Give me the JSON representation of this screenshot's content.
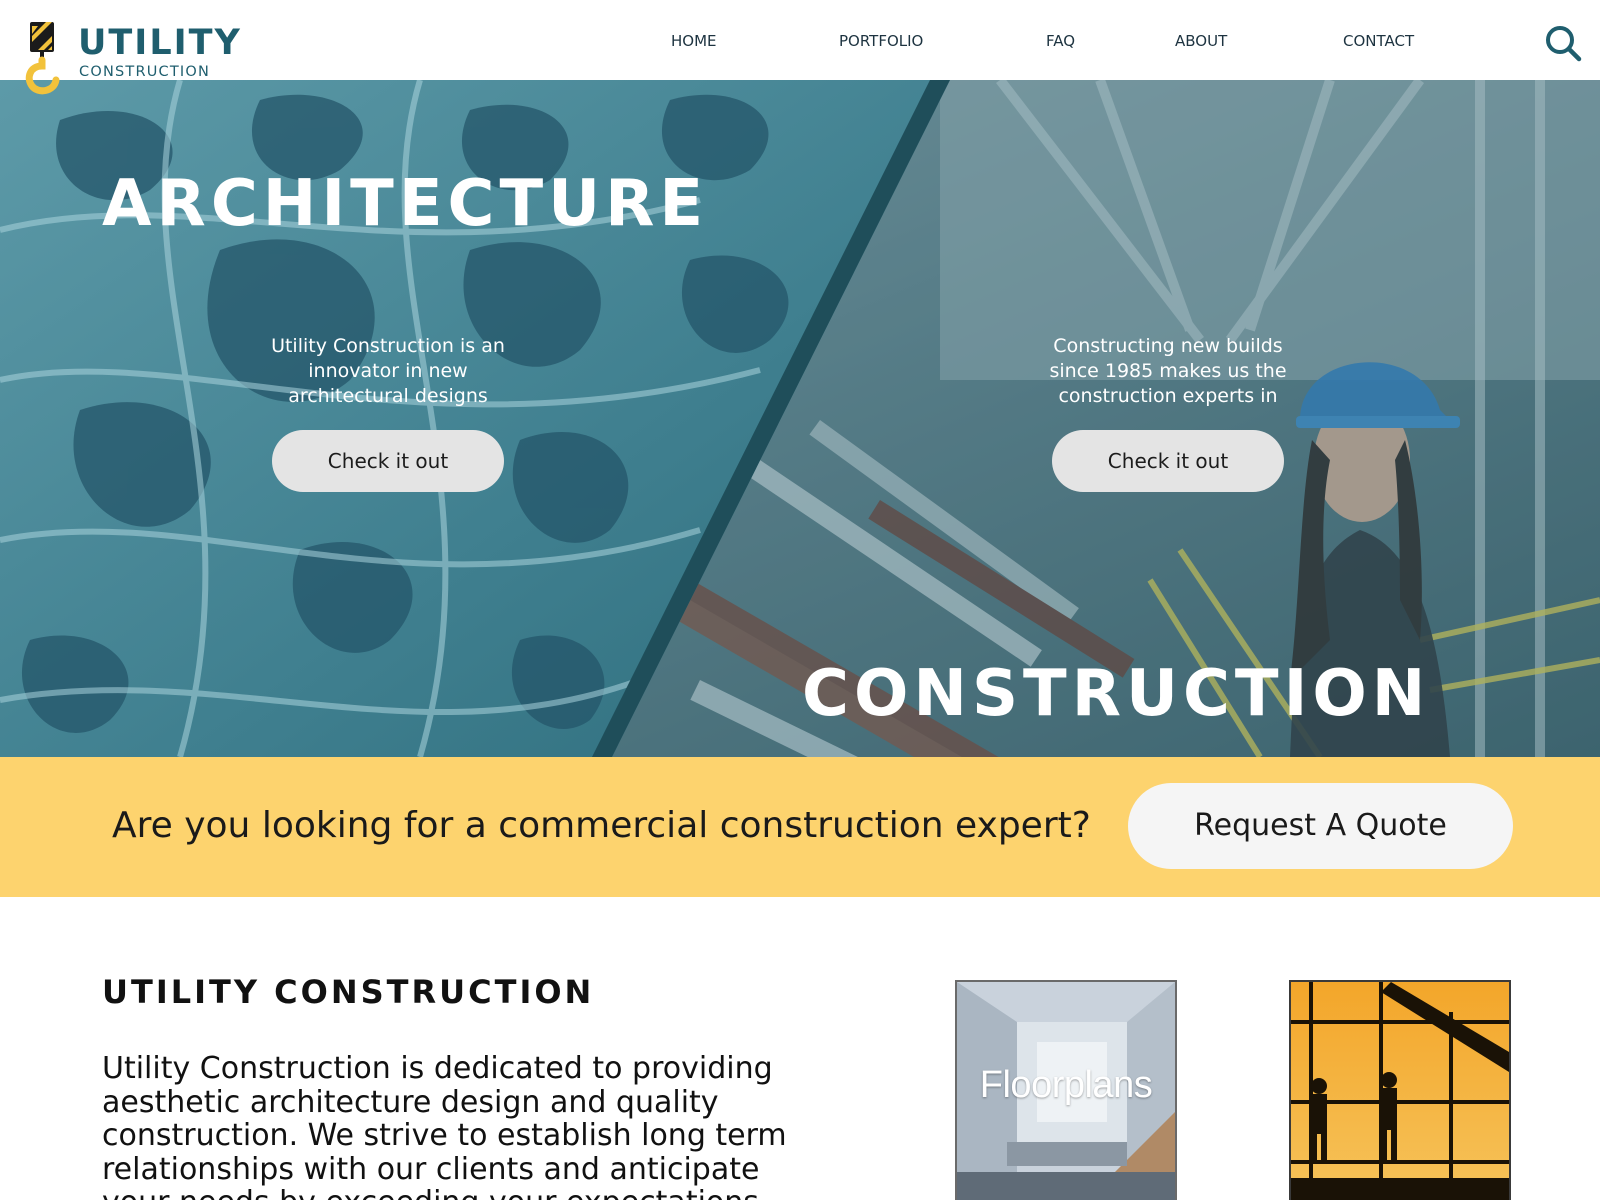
{
  "brand": {
    "name": "UTILITY",
    "tagline": "CONSTRUCTION"
  },
  "nav": {
    "items": [
      {
        "label": "HOME"
      },
      {
        "label": "PORTFOLIO"
      },
      {
        "label": "FAQ"
      },
      {
        "label": "ABOUT"
      },
      {
        "label": "CONTACT"
      }
    ],
    "search_icon": "search-icon"
  },
  "hero": {
    "left": {
      "title": "ARCHITECTURE",
      "text": "Utility Construction is an innovator in new architectural designs",
      "button_label": "Check it out"
    },
    "right": {
      "title": "CONSTRUCTION",
      "text": "Constructing new builds since 1985 makes us the construction experts in",
      "button_label": "Check it out"
    }
  },
  "quote_band": {
    "text": "Are you looking for a commercial construction expert?",
    "button_label": "Request A Quote"
  },
  "about": {
    "title": "UTILITY CONSTRUCTION",
    "body": "Utility Construction is dedicated to providing aesthetic architecture design and quality construction. We strive to establish long term relationships with our clients and anticipate your needs by exceeding your expectations by"
  },
  "thumbnails": [
    {
      "label": "Floorplans"
    },
    {
      "label": ""
    }
  ],
  "colors": {
    "brand_teal": "#1f5e6e",
    "brand_yellow": "#f2c23b",
    "band_yellow": "#fdd36e",
    "hero_overlay": "#2f7a8c",
    "button_gray": "#e4e4e4"
  }
}
